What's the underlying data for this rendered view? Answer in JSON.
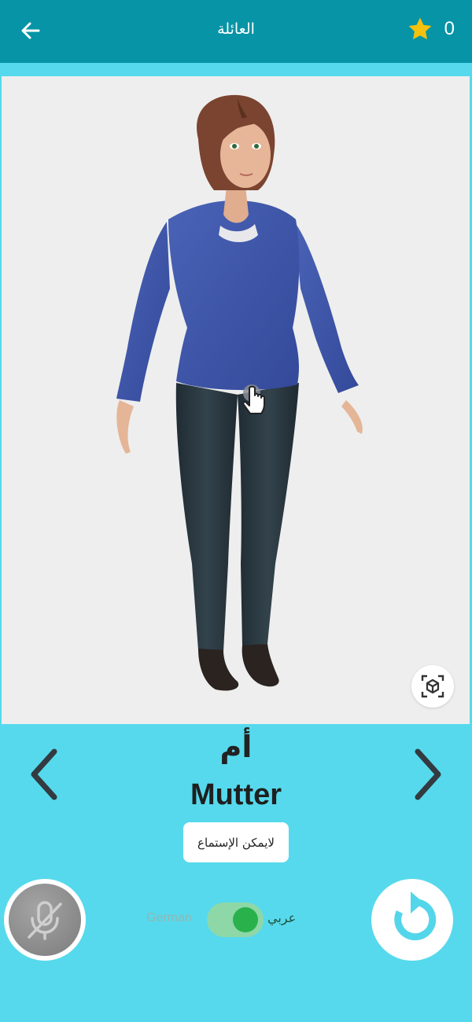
{
  "header": {
    "title": "العائلة",
    "back_icon": "arrow-left-icon",
    "score_icon": "star-icon",
    "score": "0"
  },
  "viewer": {
    "model": "3D female family-member avatar",
    "touch_hint_icon": "hand-pointer-icon",
    "ar_icon": "cube-scan-icon"
  },
  "word": {
    "arabic": "أم",
    "german": "Mutter",
    "audio_note": "لايمكن الإستماع",
    "prev_icon": "chevron-left-icon",
    "next_icon": "chevron-right-icon"
  },
  "controls": {
    "mic_icon": "mic-off-icon",
    "toggle": {
      "left_label": "German",
      "right_label": "عربي",
      "state": "on"
    },
    "reset_icon": "rotate-ccw-icon"
  },
  "colors": {
    "header": "#0694a6",
    "background": "#56d9ec",
    "star": "#f4c20d",
    "toggle_knob": "#29b24c",
    "reset_icon": "#54d6ea"
  }
}
